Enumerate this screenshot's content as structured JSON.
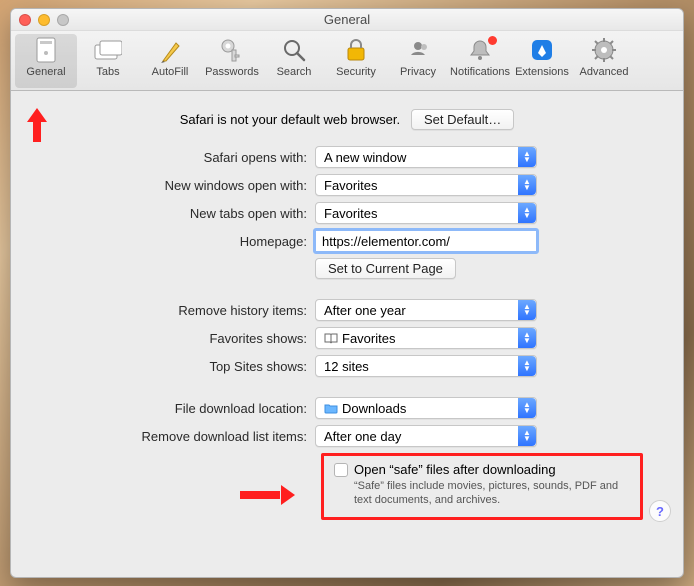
{
  "window": {
    "title": "General"
  },
  "toolbar": {
    "items": [
      {
        "label": "General",
        "icon": "general-icon",
        "selected": true
      },
      {
        "label": "Tabs",
        "icon": "tabs-icon"
      },
      {
        "label": "AutoFill",
        "icon": "autofill-icon"
      },
      {
        "label": "Passwords",
        "icon": "passwords-icon"
      },
      {
        "label": "Search",
        "icon": "search-icon"
      },
      {
        "label": "Security",
        "icon": "security-icon"
      },
      {
        "label": "Privacy",
        "icon": "privacy-icon"
      },
      {
        "label": "Notifications",
        "icon": "notifications-icon",
        "badge": true
      },
      {
        "label": "Extensions",
        "icon": "extensions-icon"
      },
      {
        "label": "Advanced",
        "icon": "advanced-icon"
      }
    ]
  },
  "default_browser": {
    "message": "Safari is not your default web browser.",
    "button": "Set Default…"
  },
  "form": {
    "opens_with": {
      "label": "Safari opens with:",
      "value": "A new window"
    },
    "new_windows": {
      "label": "New windows open with:",
      "value": "Favorites"
    },
    "new_tabs": {
      "label": "New tabs open with:",
      "value": "Favorites"
    },
    "homepage": {
      "label": "Homepage:",
      "value": "https://elementor.com/"
    },
    "set_current": {
      "button": "Set to Current Page"
    },
    "remove_history": {
      "label": "Remove history items:",
      "value": "After one year"
    },
    "favorites_shows": {
      "label": "Favorites shows:",
      "value": "Favorites",
      "icon": "book-icon"
    },
    "top_sites": {
      "label": "Top Sites shows:",
      "value": "12 sites"
    },
    "download_loc": {
      "label": "File download location:",
      "value": "Downloads",
      "icon": "folder-icon"
    },
    "remove_downloads": {
      "label": "Remove download list items:",
      "value": "After one day"
    }
  },
  "safe_files": {
    "checked": false,
    "label": "Open “safe” files after downloading",
    "desc": "“Safe” files include movies, pictures, sounds, PDF and text documents, and archives."
  },
  "help": "?"
}
